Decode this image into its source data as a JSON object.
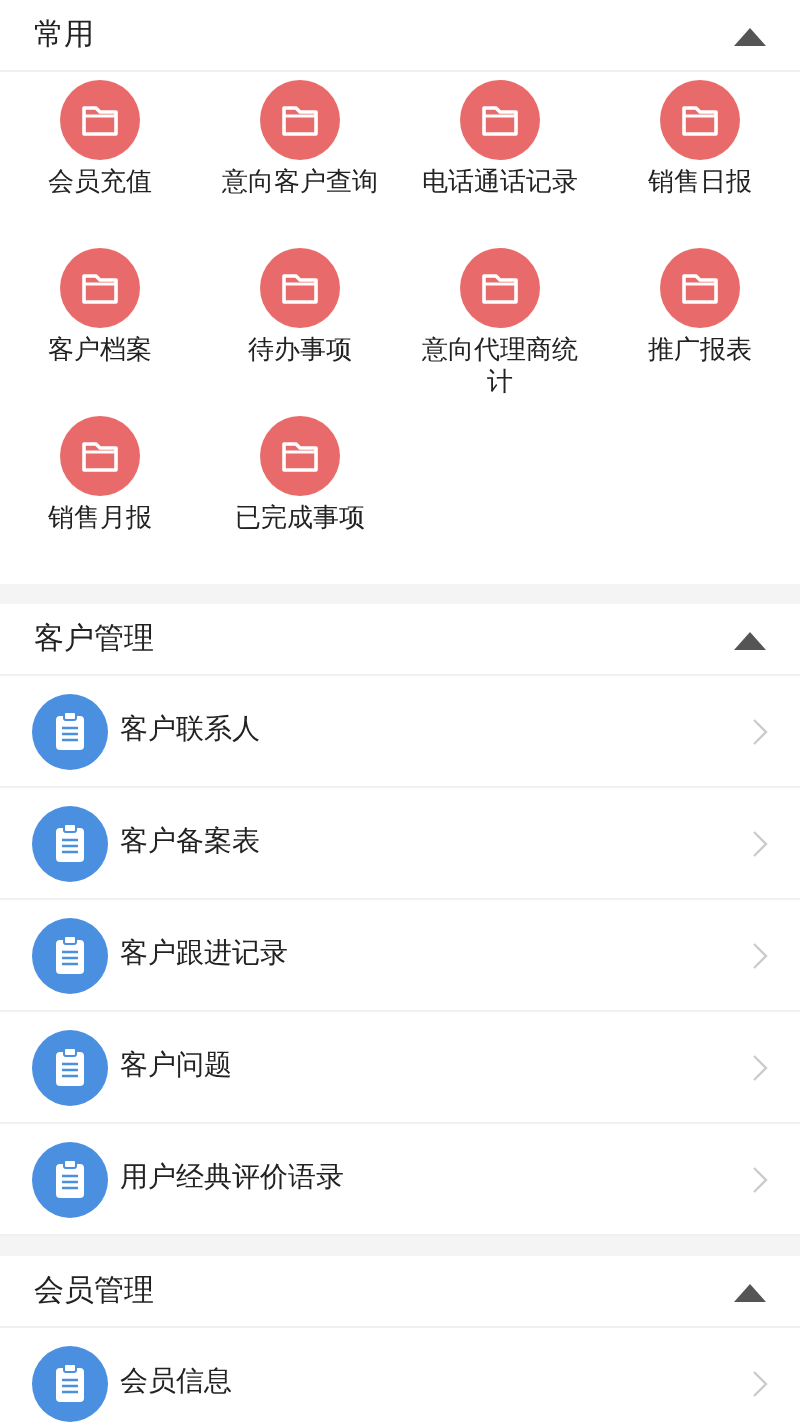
{
  "sections": [
    {
      "title": "常用",
      "expanded": true,
      "kind": "grid",
      "items": [
        {
          "label": "会员充值"
        },
        {
          "label": "意向客户查询"
        },
        {
          "label": "电话通话记录"
        },
        {
          "label": "销售日报"
        },
        {
          "label": "客户档案"
        },
        {
          "label": "待办事项"
        },
        {
          "label": "意向代理商统计"
        },
        {
          "label": "推广报表"
        },
        {
          "label": "销售月报"
        },
        {
          "label": "已完成事项"
        }
      ]
    },
    {
      "title": "客户管理",
      "expanded": true,
      "kind": "list",
      "items": [
        {
          "label": "客户联系人"
        },
        {
          "label": "客户备案表"
        },
        {
          "label": "客户跟进记录"
        },
        {
          "label": "客户问题"
        },
        {
          "label": "用户经典评价语录"
        }
      ]
    },
    {
      "title": "会员管理",
      "expanded": true,
      "kind": "list",
      "items": [
        {
          "label": "会员信息"
        }
      ]
    }
  ]
}
